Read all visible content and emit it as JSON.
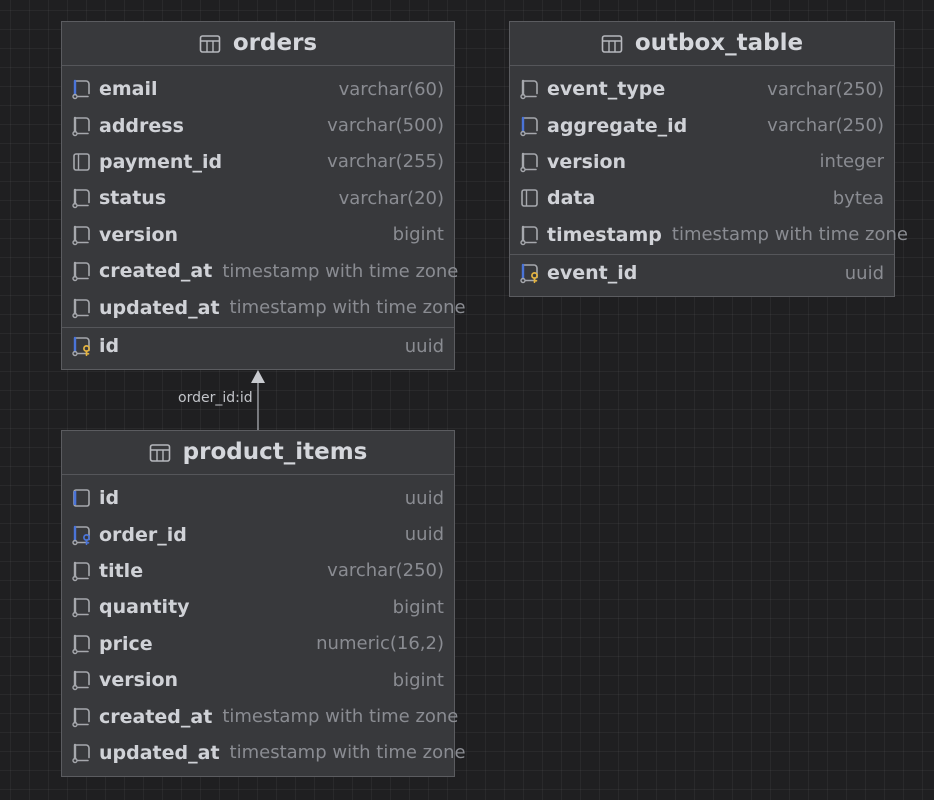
{
  "tables": {
    "orders": {
      "name": "orders",
      "columns": [
        {
          "name": "email",
          "type": "varchar(60)",
          "icon": "column-notnull-icon"
        },
        {
          "name": "address",
          "type": "varchar(500)",
          "icon": "column-icon"
        },
        {
          "name": "payment_id",
          "type": "varchar(255)",
          "icon": "column-nullable-icon"
        },
        {
          "name": "status",
          "type": "varchar(20)",
          "icon": "column-icon"
        },
        {
          "name": "version",
          "type": "bigint",
          "icon": "column-icon"
        },
        {
          "name": "created_at",
          "type": "timestamp with time zone",
          "icon": "column-icon"
        },
        {
          "name": "updated_at",
          "type": "timestamp with time zone",
          "icon": "column-icon"
        }
      ],
      "primary_key": {
        "name": "id",
        "type": "uuid",
        "icon": "primary-key-icon"
      }
    },
    "outbox_table": {
      "name": "outbox_table",
      "columns": [
        {
          "name": "event_type",
          "type": "varchar(250)",
          "icon": "column-icon"
        },
        {
          "name": "aggregate_id",
          "type": "varchar(250)",
          "icon": "column-notnull-icon"
        },
        {
          "name": "version",
          "type": "integer",
          "icon": "column-icon"
        },
        {
          "name": "data",
          "type": "bytea",
          "icon": "column-nullable-icon"
        },
        {
          "name": "timestamp",
          "type": "timestamp with time zone",
          "icon": "column-icon"
        }
      ],
      "primary_key": {
        "name": "event_id",
        "type": "uuid",
        "icon": "primary-key-icon"
      }
    },
    "product_items": {
      "name": "product_items",
      "columns": [
        {
          "name": "id",
          "type": "uuid",
          "icon": "column-unique-icon"
        },
        {
          "name": "order_id",
          "type": "uuid",
          "icon": "foreign-key-icon"
        },
        {
          "name": "title",
          "type": "varchar(250)",
          "icon": "column-icon"
        },
        {
          "name": "quantity",
          "type": "bigint",
          "icon": "column-icon"
        },
        {
          "name": "price",
          "type": "numeric(16,2)",
          "icon": "column-icon"
        },
        {
          "name": "version",
          "type": "bigint",
          "icon": "column-icon"
        },
        {
          "name": "created_at",
          "type": "timestamp with time zone",
          "icon": "column-icon"
        },
        {
          "name": "updated_at",
          "type": "timestamp with time zone",
          "icon": "column-icon"
        }
      ]
    }
  },
  "relations": [
    {
      "from": "product_items",
      "to": "orders",
      "label": "order_id:id"
    }
  ],
  "colors": {
    "background": "#1f1f21",
    "table_fill": "#38393c",
    "table_border": "#5b5c60",
    "name_text": "#d0d2d7",
    "type_text": "#8a8c92",
    "icon_gray": "#a6a8ad",
    "icon_blue": "#4a74d9",
    "key_gold": "#e3b341"
  }
}
